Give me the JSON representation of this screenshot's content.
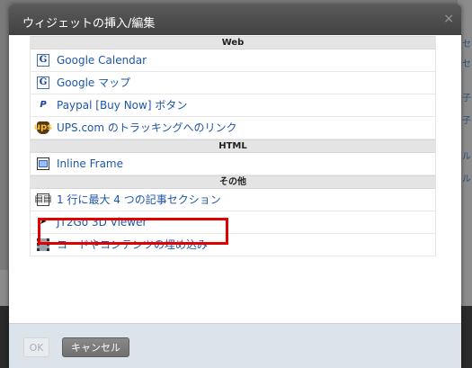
{
  "dialog": {
    "title": "ウィジェットの挿入/編集",
    "close_icon": "×"
  },
  "categories": {
    "web": "Web",
    "html": "HTML",
    "other": "その他"
  },
  "items": {
    "web": [
      {
        "label": "Google Calendar",
        "icon": "google-icon",
        "glyph": "G"
      },
      {
        "label": "Google マップ",
        "icon": "google-icon",
        "glyph": "G"
      },
      {
        "label": "Paypal [Buy Now] ボタン",
        "icon": "paypal-icon",
        "glyph": "P"
      },
      {
        "label": "UPS.com のトラッキングへのリンク",
        "icon": "ups-icon",
        "glyph": "ups"
      }
    ],
    "html": [
      {
        "label": "Inline Frame",
        "icon": "frame-icon"
      }
    ],
    "other": [
      {
        "label": "1 行に最大 4 つの記事セクション",
        "icon": "article-sections-icon",
        "glyph": "▤▤"
      },
      {
        "label": "JT2Go 3D Viewer",
        "icon": "jt2go-icon",
        "glyph": "➤"
      },
      {
        "label": "コードやコンテンツの埋め込み",
        "icon": "film-icon"
      }
    ]
  },
  "background": {
    "right_texts": [
      "セ",
      "セ",
      "子",
      "子",
      "ル",
      "ル"
    ]
  },
  "footer": {
    "ok_label": "OK",
    "cancel_label": "キャンセル"
  },
  "colors": {
    "link": "#1f57a8",
    "highlight": "#e00000",
    "titlebar": "#4a4a4a"
  }
}
